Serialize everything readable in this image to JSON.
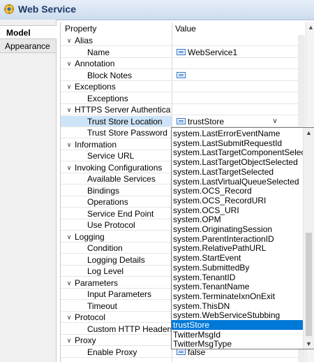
{
  "header": {
    "title": "Web Service",
    "icon": "web-service-icon"
  },
  "tabs": [
    {
      "label": "Model",
      "active": true
    },
    {
      "label": "Appearance",
      "active": false
    }
  ],
  "table": {
    "col_property": "Property",
    "col_value": "Value",
    "rows": [
      {
        "type": "group",
        "label": "Alias"
      },
      {
        "type": "prop",
        "label": "Name",
        "value": "WebService1",
        "icon": true
      },
      {
        "type": "group",
        "label": "Annotation"
      },
      {
        "type": "prop",
        "label": "Block Notes",
        "value": "",
        "icon": true
      },
      {
        "type": "group",
        "label": "Exceptions"
      },
      {
        "type": "prop",
        "label": "Exceptions",
        "value": ""
      },
      {
        "type": "group",
        "label": "HTTPS Server Authentication"
      },
      {
        "type": "prop",
        "label": "Trust Store Location",
        "value": "trustStore",
        "icon": true,
        "selected": true,
        "dropdown": true
      },
      {
        "type": "prop",
        "label": "Trust Store Password",
        "value": ""
      },
      {
        "type": "group",
        "label": "Information"
      },
      {
        "type": "prop",
        "label": "Service URL",
        "value": ""
      },
      {
        "type": "group",
        "label": "Invoking Configurations"
      },
      {
        "type": "prop",
        "label": "Available Services",
        "value": ""
      },
      {
        "type": "prop",
        "label": "Bindings",
        "value": ""
      },
      {
        "type": "prop",
        "label": "Operations",
        "value": ""
      },
      {
        "type": "prop",
        "label": "Service End Point",
        "value": ""
      },
      {
        "type": "prop",
        "label": "Use Protocol",
        "value": ""
      },
      {
        "type": "group",
        "label": "Logging"
      },
      {
        "type": "prop",
        "label": "Condition",
        "value": ""
      },
      {
        "type": "prop",
        "label": "Logging Details",
        "value": ""
      },
      {
        "type": "prop",
        "label": "Log Level",
        "value": ""
      },
      {
        "type": "group",
        "label": "Parameters"
      },
      {
        "type": "prop",
        "label": "Input Parameters",
        "value": ""
      },
      {
        "type": "prop",
        "label": "Timeout",
        "value": ""
      },
      {
        "type": "group",
        "label": "Protocol"
      },
      {
        "type": "prop",
        "label": "Custom HTTP Headers",
        "value": ""
      },
      {
        "type": "group",
        "label": "Proxy"
      },
      {
        "type": "prop",
        "label": "Enable Proxy",
        "value": "false",
        "icon": true
      }
    ]
  },
  "dropdown": {
    "selected_value": "trustStore",
    "items": [
      "system.LastErrorEventName",
      "system.LastSubmitRequestId",
      "system.LastTargetComponentSelected",
      "system.LastTargetObjectSelected",
      "system.LastTargetSelected",
      "system.LastVirtualQueueSelected",
      "system.OCS_Record",
      "system.OCS_RecordURI",
      "system.OCS_URI",
      "system.OPM",
      "system.OriginatingSession",
      "system.ParentInteractionID",
      "system.RelativePathURL",
      "system.StartEvent",
      "system.SubmittedBy",
      "system.TenantID",
      "system.TenantName",
      "system.TerminateIxnOnExit",
      "system.ThisDN",
      "system.WebServiceStubbing",
      "trustStore",
      "TwitterMsgId",
      "TwitterMsgType"
    ]
  },
  "colors": {
    "selection": "#0078d7",
    "row_selected": "#cde3f7",
    "header_text": "#1c3a66"
  }
}
